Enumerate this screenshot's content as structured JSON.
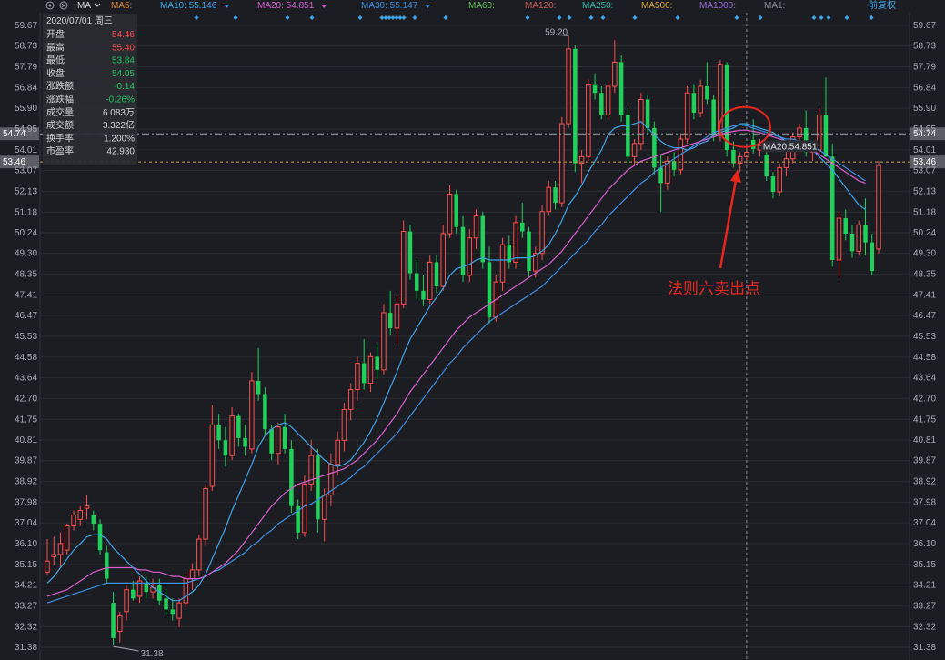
{
  "toolbar": {
    "indicator": "MA",
    "ma_items": [
      {
        "label": "MA5:",
        "value": "",
        "color": "#e0883a"
      },
      {
        "label": "MA10:",
        "value": "55.146",
        "color": "#3ea6e8"
      },
      {
        "label": "MA20:",
        "value": "54.851",
        "color": "#d95fd0"
      },
      {
        "label": "MA30:",
        "value": "55.147",
        "color": "#3d8fe0"
      },
      {
        "label": "MA60:",
        "value": "",
        "color": "#5fbf5a"
      },
      {
        "label": "MA120:",
        "value": "",
        "color": "#c55e5e"
      },
      {
        "label": "MA250:",
        "value": "",
        "color": "#33b8a8"
      },
      {
        "label": "MA500:",
        "value": "",
        "color": "#d9a23c"
      },
      {
        "label": "MA1000:",
        "value": "",
        "color": "#9a6fd8"
      },
      {
        "label": "MA1:",
        "value": "",
        "color": "#8a8d94"
      }
    ],
    "adjust_label": "前复权",
    "icons": [
      "settings-icon",
      "close-icon",
      "chevron-down-icon"
    ]
  },
  "info_panel": {
    "date": "2020/07/01 周三",
    "rows": [
      {
        "label": "开盘",
        "value": "54.46",
        "color": "#ff4d4d"
      },
      {
        "label": "最高",
        "value": "55.40",
        "color": "#ff4d4d"
      },
      {
        "label": "最低",
        "value": "53.84",
        "color": "#22c55e"
      },
      {
        "label": "收盘",
        "value": "54.05",
        "color": "#22c55e"
      },
      {
        "label": "涨跌额",
        "value": "-0.14",
        "color": "#22c55e"
      },
      {
        "label": "涨跌幅",
        "value": "-0.26%",
        "color": "#22c55e"
      },
      {
        "label": "成交量",
        "value": "6.083万",
        "color": "#d2d4d8"
      },
      {
        "label": "成交额",
        "value": "3.322亿",
        "color": "#d2d4d8"
      },
      {
        "label": "换手率",
        "value": "1.200%",
        "color": "#d2d4d8"
      },
      {
        "label": "市盈率",
        "value": "42.930",
        "color": "#d2d4d8"
      }
    ]
  },
  "annotation": {
    "text": "法则六卖出点",
    "color": "#e8261e"
  },
  "chart_data": {
    "type": "candlestick",
    "y_ticks": [
      "59.67",
      "58.73",
      "57.79",
      "56.84",
      "55.90",
      "54.95",
      "54.01",
      "53.07",
      "52.13",
      "51.18",
      "50.24",
      "49.30",
      "48.35",
      "47.41",
      "46.47",
      "45.53",
      "44.58",
      "43.64",
      "42.70",
      "41.75",
      "40.81",
      "39.87",
      "38.92",
      "37.98",
      "37.04",
      "36.10",
      "35.15",
      "34.21",
      "33.27",
      "32.32",
      "31.38"
    ],
    "ylim": [
      31.38,
      59.67
    ],
    "price_tags": [
      {
        "value": "54.74",
        "style": "dash-dot",
        "color": "#9aa0a8"
      },
      {
        "value": "53.46",
        "style": "dashed",
        "color": "#c8a04a"
      }
    ],
    "crosshair_label": "MA20:54.851",
    "high_label": "59.20",
    "low_label": "31.38",
    "colors": {
      "up": "#ff4d4d",
      "down": "#1fd15a",
      "ma10": "#3ea6e8",
      "ma20": "#d95fd0",
      "ma30": "#3d8fe0"
    },
    "candles": [
      [
        34.8,
        36.3,
        34.7,
        35.3
      ],
      [
        35.5,
        36.4,
        35.1,
        35.6
      ],
      [
        35.6,
        36.6,
        35.0,
        36.1
      ],
      [
        35.8,
        37.0,
        35.6,
        36.9
      ],
      [
        36.9,
        37.6,
        36.7,
        37.4
      ],
      [
        37.2,
        37.8,
        36.9,
        37.6
      ],
      [
        37.7,
        38.3,
        37.2,
        37.8
      ],
      [
        37.4,
        37.6,
        36.7,
        37.0
      ],
      [
        37.0,
        37.2,
        35.6,
        35.8
      ],
      [
        35.7,
        36.0,
        34.3,
        34.5
      ],
      [
        33.4,
        33.9,
        31.5,
        31.8
      ],
      [
        32.1,
        33.0,
        31.6,
        32.8
      ],
      [
        33.0,
        34.2,
        32.6,
        34.0
      ],
      [
        34.0,
        34.4,
        33.5,
        33.6
      ],
      [
        33.7,
        34.6,
        33.4,
        34.4
      ],
      [
        34.3,
        34.6,
        33.6,
        33.9
      ],
      [
        33.9,
        34.5,
        33.6,
        34.1
      ],
      [
        34.2,
        34.5,
        33.3,
        33.5
      ],
      [
        33.6,
        34.0,
        32.9,
        33.1
      ],
      [
        33.1,
        33.6,
        32.6,
        32.9
      ],
      [
        32.7,
        33.6,
        32.3,
        33.4
      ],
      [
        33.4,
        34.8,
        33.2,
        34.5
      ],
      [
        34.5,
        35.2,
        34.0,
        34.9
      ],
      [
        34.9,
        36.5,
        34.6,
        36.3
      ],
      [
        36.3,
        38.8,
        36.0,
        38.6
      ],
      [
        38.7,
        42.4,
        38.5,
        41.5
      ],
      [
        41.5,
        42.0,
        40.4,
        40.8
      ],
      [
        40.8,
        41.4,
        39.6,
        40.1
      ],
      [
        40.1,
        42.3,
        39.9,
        41.9
      ],
      [
        41.9,
        42.0,
        40.5,
        40.9
      ],
      [
        40.9,
        41.5,
        40.1,
        40.5
      ],
      [
        40.4,
        43.9,
        40.2,
        43.5
      ],
      [
        43.5,
        45.0,
        42.6,
        42.9
      ],
      [
        42.9,
        43.2,
        41.0,
        41.3
      ],
      [
        41.3,
        41.5,
        39.9,
        40.2
      ],
      [
        40.2,
        41.6,
        39.7,
        41.4
      ],
      [
        41.4,
        42.0,
        40.2,
        40.4
      ],
      [
        40.4,
        40.8,
        37.5,
        37.8
      ],
      [
        37.8,
        38.1,
        36.3,
        36.6
      ],
      [
        36.6,
        39.2,
        36.4,
        38.8
      ],
      [
        38.8,
        40.8,
        38.5,
        40.1
      ],
      [
        40.1,
        40.4,
        36.6,
        37.2
      ],
      [
        37.2,
        38.6,
        36.2,
        38.3
      ],
      [
        38.3,
        40.2,
        37.8,
        39.7
      ],
      [
        39.7,
        41.2,
        39.2,
        40.8
      ],
      [
        40.8,
        42.5,
        40.3,
        42.2
      ],
      [
        42.2,
        43.4,
        41.7,
        43.1
      ],
      [
        43.1,
        44.6,
        42.6,
        44.3
      ],
      [
        44.3,
        45.4,
        43.1,
        43.4
      ],
      [
        43.4,
        44.8,
        43.0,
        44.6
      ],
      [
        44.6,
        45.2,
        43.6,
        44.0
      ],
      [
        44.0,
        47.0,
        43.8,
        46.6
      ],
      [
        46.6,
        47.6,
        45.6,
        45.9
      ],
      [
        45.9,
        47.4,
        45.2,
        47.0
      ],
      [
        47.0,
        50.8,
        46.8,
        50.3
      ],
      [
        50.3,
        50.6,
        48.1,
        48.4
      ],
      [
        48.4,
        49.0,
        47.2,
        47.6
      ],
      [
        47.6,
        48.3,
        46.9,
        47.2
      ],
      [
        47.2,
        49.2,
        47.0,
        48.9
      ],
      [
        48.9,
        49.2,
        47.5,
        47.8
      ],
      [
        47.8,
        50.6,
        47.6,
        50.2
      ],
      [
        50.2,
        52.4,
        50.0,
        52.0
      ],
      [
        52.0,
        52.2,
        50.2,
        50.5
      ],
      [
        50.5,
        51.0,
        48.0,
        48.3
      ],
      [
        48.3,
        50.4,
        48.0,
        50.0
      ],
      [
        50.0,
        51.3,
        49.5,
        51.0
      ],
      [
        51.0,
        51.2,
        48.6,
        48.9
      ],
      [
        48.9,
        49.6,
        46.1,
        46.4
      ],
      [
        46.4,
        48.3,
        46.2,
        48.0
      ],
      [
        48.0,
        50.0,
        47.6,
        49.7
      ],
      [
        49.7,
        50.1,
        48.6,
        48.9
      ],
      [
        48.9,
        51.0,
        48.6,
        50.7
      ],
      [
        50.7,
        51.6,
        50.0,
        50.3
      ],
      [
        50.3,
        50.5,
        48.2,
        48.5
      ],
      [
        48.5,
        49.6,
        48.2,
        49.3
      ],
      [
        49.3,
        51.5,
        49.0,
        51.2
      ],
      [
        51.2,
        52.6,
        51.0,
        52.3
      ],
      [
        52.3,
        52.6,
        51.3,
        51.6
      ],
      [
        51.6,
        55.5,
        51.4,
        55.2
      ],
      [
        55.2,
        59.2,
        55.0,
        58.6
      ],
      [
        58.6,
        58.8,
        53.0,
        53.4
      ],
      [
        53.4,
        54.0,
        52.5,
        53.7
      ],
      [
        53.7,
        57.2,
        53.5,
        57.0
      ],
      [
        57.0,
        57.5,
        56.3,
        56.6
      ],
      [
        56.6,
        56.9,
        55.4,
        55.6
      ],
      [
        55.6,
        57.1,
        55.4,
        56.9
      ],
      [
        56.9,
        59.0,
        56.6,
        58.0
      ],
      [
        58.0,
        58.3,
        55.3,
        55.6
      ],
      [
        55.6,
        55.9,
        53.4,
        53.7
      ],
      [
        53.7,
        54.5,
        53.3,
        54.3
      ],
      [
        54.3,
        56.6,
        54.0,
        56.3
      ],
      [
        56.3,
        56.5,
        54.7,
        55.0
      ],
      [
        55.0,
        55.3,
        52.9,
        53.2
      ],
      [
        53.2,
        53.8,
        51.2,
        52.5
      ],
      [
        52.5,
        53.7,
        52.2,
        53.5
      ],
      [
        53.5,
        53.9,
        52.8,
        53.1
      ],
      [
        53.1,
        54.7,
        52.9,
        54.5
      ],
      [
        54.5,
        56.9,
        54.3,
        56.6
      ],
      [
        56.6,
        57.0,
        55.4,
        55.7
      ],
      [
        55.7,
        57.2,
        55.5,
        56.9
      ],
      [
        56.9,
        58.0,
        56.1,
        56.3
      ],
      [
        56.3,
        56.5,
        54.4,
        54.7
      ],
      [
        54.7,
        58.1,
        54.4,
        57.9
      ],
      [
        57.9,
        58.0,
        53.7,
        54.0
      ],
      [
        54.0,
        54.4,
        53.2,
        53.4
      ],
      [
        53.4,
        53.9,
        53.0,
        53.7
      ],
      [
        53.7,
        54.1,
        53.4,
        53.9
      ],
      [
        54.46,
        55.4,
        53.84,
        54.05
      ],
      [
        54.0,
        54.5,
        53.7,
        54.2
      ],
      [
        53.8,
        54.1,
        52.6,
        52.8
      ],
      [
        52.8,
        53.0,
        51.8,
        52.1
      ],
      [
        52.1,
        53.4,
        51.9,
        53.2
      ],
      [
        53.2,
        54.0,
        52.8,
        53.6
      ],
      [
        53.6,
        54.8,
        53.4,
        54.6
      ],
      [
        54.6,
        55.2,
        54.2,
        55.0
      ],
      [
        55.0,
        55.8,
        53.7,
        53.9
      ],
      [
        53.9,
        54.2,
        53.5,
        54.0
      ],
      [
        54.0,
        55.9,
        53.8,
        55.6
      ],
      [
        55.6,
        57.3,
        55.3,
        53.7
      ],
      [
        53.7,
        54.3,
        48.7,
        49.0
      ],
      [
        49.0,
        51.2,
        48.2,
        50.9
      ],
      [
        50.9,
        51.3,
        49.9,
        50.2
      ],
      [
        50.2,
        50.6,
        49.1,
        49.4
      ],
      [
        49.4,
        50.8,
        49.2,
        50.6
      ],
      [
        50.6,
        51.8,
        49.2,
        49.8
      ],
      [
        49.8,
        50.2,
        48.3,
        48.5
      ],
      [
        49.5,
        53.5,
        49.3,
        53.3
      ]
    ],
    "ma10": [
      34.3,
      34.6,
      35.0,
      35.4,
      35.8,
      36.1,
      36.4,
      36.5,
      36.5,
      36.3,
      35.9,
      35.6,
      35.3,
      35.0,
      34.7,
      34.4,
      34.1,
      33.9,
      33.7,
      33.5,
      33.5,
      33.7,
      33.9,
      34.2,
      34.7,
      35.4,
      36.1,
      36.8,
      37.6,
      38.3,
      39.0,
      39.7,
      40.5,
      41.0,
      41.3,
      41.5,
      41.6,
      41.4,
      41.1,
      40.8,
      40.5,
      40.2,
      39.9,
      39.7,
      39.6,
      39.7,
      39.9,
      40.3,
      40.7,
      41.2,
      41.8,
      42.5,
      43.2,
      43.9,
      44.7,
      45.4,
      45.9,
      46.4,
      46.9,
      47.3,
      47.7,
      48.3,
      48.6,
      48.7,
      48.8,
      49.0,
      49.1,
      49.0,
      49.0,
      49.0,
      49.0,
      49.1,
      49.1,
      49.1,
      49.2,
      49.4,
      49.7,
      50.2,
      50.8,
      51.5,
      51.9,
      52.4,
      53.0,
      53.5,
      54.0,
      54.7,
      55.0,
      55.1,
      55.1,
      55.2,
      55.3,
      55.0,
      54.7,
      54.4,
      54.2,
      54.1,
      54.1,
      54.0,
      54.1,
      54.3,
      54.4,
      54.7,
      54.8,
      54.9,
      55.0,
      55.2,
      55.2,
      55.1,
      55.0,
      54.9,
      54.8,
      54.6,
      54.4,
      54.2,
      54.1,
      54.1,
      54.0,
      53.7,
      53.4,
      53.1,
      52.7,
      52.3,
      51.9,
      51.5,
      51.3
    ],
    "ma20": [
      33.7,
      33.8,
      33.9,
      34.0,
      34.2,
      34.4,
      34.6,
      34.8,
      34.9,
      35.0,
      35.0,
      35.0,
      35.0,
      35.0,
      34.9,
      34.9,
      34.8,
      34.8,
      34.7,
      34.6,
      34.6,
      34.5,
      34.5,
      34.5,
      34.6,
      34.8,
      35.0,
      35.2,
      35.5,
      35.8,
      36.2,
      36.6,
      37.0,
      37.4,
      37.8,
      38.1,
      38.4,
      38.6,
      38.8,
      38.9,
      39.0,
      39.1,
      39.2,
      39.3,
      39.4,
      39.5,
      39.7,
      39.9,
      40.2,
      40.5,
      40.8,
      41.2,
      41.6,
      42.0,
      42.5,
      43.0,
      43.4,
      43.8,
      44.2,
      44.6,
      45.0,
      45.4,
      45.8,
      46.1,
      46.4,
      46.6,
      46.8,
      47.0,
      47.2,
      47.4,
      47.6,
      47.8,
      48.0,
      48.2,
      48.4,
      48.6,
      48.8,
      49.1,
      49.4,
      49.8,
      50.2,
      50.6,
      51.0,
      51.4,
      51.8,
      52.2,
      52.5,
      52.8,
      53.1,
      53.3,
      53.5,
      53.6,
      53.7,
      53.8,
      53.9,
      54.0,
      54.1,
      54.2,
      54.3,
      54.4,
      54.5,
      54.6,
      54.7,
      54.8,
      54.85,
      54.9,
      54.9,
      54.85,
      54.8,
      54.7,
      54.6,
      54.5,
      54.4,
      54.3,
      54.2,
      54.1,
      54.0,
      53.8,
      53.6,
      53.4,
      53.2,
      53.0,
      52.8,
      52.6,
      52.5
    ],
    "ma30": [
      33.4,
      33.5,
      33.6,
      33.7,
      33.8,
      33.9,
      34.0,
      34.1,
      34.2,
      34.3,
      34.3,
      34.3,
      34.3,
      34.3,
      34.3,
      34.3,
      34.3,
      34.3,
      34.3,
      34.3,
      34.3,
      34.3,
      34.4,
      34.5,
      34.6,
      34.8,
      34.9,
      35.1,
      35.3,
      35.5,
      35.7,
      36.0,
      36.2,
      36.5,
      36.7,
      37.0,
      37.2,
      37.4,
      37.6,
      37.8,
      37.9,
      38.1,
      38.3,
      38.5,
      38.7,
      38.9,
      39.1,
      39.4,
      39.6,
      39.9,
      40.2,
      40.5,
      40.8,
      41.1,
      41.5,
      41.9,
      42.3,
      42.7,
      43.1,
      43.5,
      43.9,
      44.3,
      44.6,
      45.0,
      45.3,
      45.6,
      45.9,
      46.2,
      46.4,
      46.6,
      46.8,
      47.0,
      47.2,
      47.4,
      47.6,
      47.8,
      48.1,
      48.4,
      48.7,
      49.0,
      49.3,
      49.6,
      49.9,
      50.3,
      50.6,
      51.0,
      51.3,
      51.6,
      51.9,
      52.2,
      52.5,
      52.7,
      53.0,
      53.2,
      53.4,
      53.6,
      53.8,
      54.0,
      54.2,
      54.4,
      54.6,
      54.8,
      54.9,
      55.0,
      55.1,
      55.15,
      55.1,
      55.0,
      54.9,
      54.8,
      54.7,
      54.6,
      54.5,
      54.5,
      54.4,
      54.3,
      54.2,
      54.0,
      53.8,
      53.6,
      53.4,
      53.2,
      53.0,
      52.8,
      52.6
    ]
  }
}
